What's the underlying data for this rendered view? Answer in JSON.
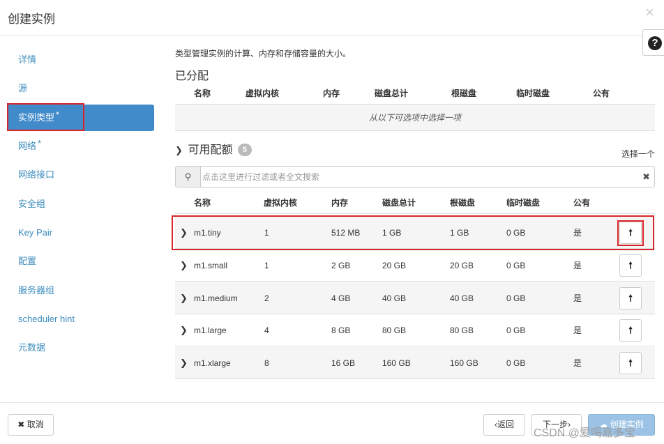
{
  "dialog": {
    "title": "创建实例",
    "close_icon": "×",
    "help_icon": "?"
  },
  "sidebar": {
    "items": [
      {
        "label": "详情",
        "required": false
      },
      {
        "label": "源",
        "required": false
      },
      {
        "label": "实例类型",
        "required": true
      },
      {
        "label": "网络",
        "required": true
      },
      {
        "label": "网络接口",
        "required": false
      },
      {
        "label": "安全组",
        "required": false
      },
      {
        "label": "Key Pair",
        "required": false
      },
      {
        "label": "配置",
        "required": false
      },
      {
        "label": "服务器组",
        "required": false
      },
      {
        "label": "scheduler hint",
        "required": false
      },
      {
        "label": "元数据",
        "required": false
      }
    ],
    "active_index": 2,
    "required_marker": "*"
  },
  "main": {
    "description": "类型管理实例的计算、内存和存储容量的大小。",
    "allocated": {
      "title": "已分配",
      "columns": [
        "名称",
        "虚拟内核",
        "内存",
        "磁盘总计",
        "根磁盘",
        "临时磁盘",
        "公有"
      ],
      "empty_text": "从以下可选项中选择一项"
    },
    "available": {
      "title": "可用配额",
      "count": "5",
      "select_hint": "选择一个",
      "search_placeholder": "点击这里进行过滤或者全文搜索",
      "search_value": "",
      "columns": [
        "名称",
        "虚拟内核",
        "内存",
        "磁盘总计",
        "根磁盘",
        "临时磁盘",
        "公有"
      ],
      "rows": [
        [
          "m1.tiny",
          "1",
          "512 MB",
          "1 GB",
          "1 GB",
          "0 GB",
          "是"
        ],
        [
          "m1.small",
          "1",
          "2 GB",
          "20 GB",
          "20 GB",
          "0 GB",
          "是"
        ],
        [
          "m1.medium",
          "2",
          "4 GB",
          "40 GB",
          "40 GB",
          "0 GB",
          "是"
        ],
        [
          "m1.large",
          "4",
          "8 GB",
          "80 GB",
          "80 GB",
          "0 GB",
          "是"
        ],
        [
          "m1.xlarge",
          "8",
          "16 GB",
          "160 GB",
          "160 GB",
          "0 GB",
          "是"
        ]
      ]
    }
  },
  "footer": {
    "cancel_label": "取消",
    "back_label": "‹返回",
    "next_label": "下一步›",
    "create_label": "创建实例"
  },
  "watermark": "CSDN @爱喝嘉多宝",
  "colors": {
    "accent": "#428bca",
    "link": "#3c8dbc",
    "highlight_border": "#d9262b",
    "primary_disabled": "#9cc3e6"
  }
}
